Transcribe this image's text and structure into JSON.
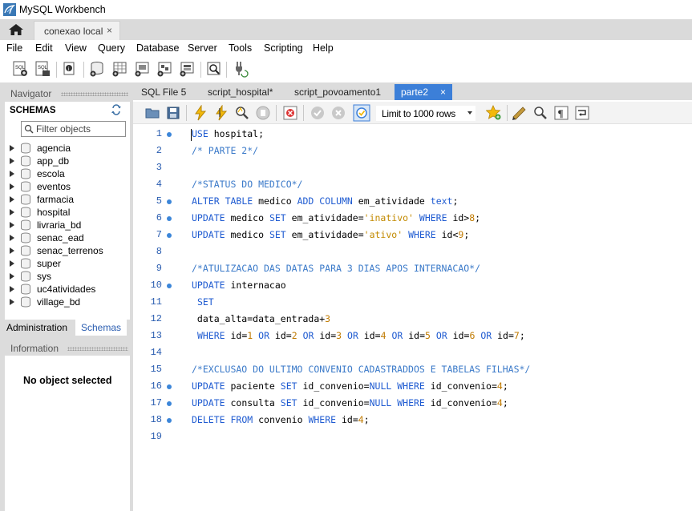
{
  "window": {
    "title": "MySQL Workbench"
  },
  "connection_tab": {
    "label": "conexao local",
    "close": "×"
  },
  "menu": [
    "File",
    "Edit",
    "View",
    "Query",
    "Database",
    "Server",
    "Tools",
    "Scripting",
    "Help"
  ],
  "main_toolbar_icons": [
    "new-sql-tab-icon",
    "open-sql-script-icon",
    "inspector-icon",
    "create-schema-icon",
    "create-table-icon",
    "create-view-icon",
    "create-procedure-icon",
    "create-function-icon",
    "search-table-data-icon",
    "reconnect-icon"
  ],
  "navigator": {
    "title": "Navigator",
    "schemas_title": "SCHEMAS",
    "filter_placeholder": "Filter objects",
    "schemas": [
      "agencia",
      "app_db",
      "escola",
      "eventos",
      "farmacia",
      "hospital",
      "livraria_bd",
      "senac_ead",
      "senac_terrenos",
      "super",
      "sys",
      "uc4atividades",
      "village_bd"
    ],
    "tabs": [
      "Administration",
      "Schemas"
    ],
    "information_title": "Information",
    "no_object": "No object selected"
  },
  "editor": {
    "tabs": [
      {
        "label": "SQL File 5",
        "active": false
      },
      {
        "label": "script_hospital*",
        "active": false
      },
      {
        "label": "script_povoamento1",
        "active": false
      },
      {
        "label": "parte2",
        "active": true,
        "close": "×"
      }
    ],
    "limit_rows": "Limit to 1000 rows",
    "toolbar_icons": [
      "open-file-icon",
      "save-icon",
      "execute-icon",
      "execute-current-icon",
      "explain-icon",
      "stop-icon",
      "toggle-error-icon",
      "commit-icon",
      "rollback-icon",
      "autocommit-icon",
      "limit-rows-select",
      "bookmark-icon",
      "beautify-icon",
      "find-icon",
      "invisible-chars-icon",
      "wrap-icon"
    ],
    "lines": [
      {
        "n": "1",
        "bullet": true,
        "code": "USE hospital;"
      },
      {
        "n": "2",
        "bullet": false,
        "code": "/* PARTE 2*/"
      },
      {
        "n": "3",
        "bullet": false,
        "code": ""
      },
      {
        "n": "4",
        "bullet": false,
        "code": "/*STATUS DO MEDICO*/"
      },
      {
        "n": "5",
        "bullet": true,
        "code": "ALTER TABLE medico ADD COLUMN em_atividade text;"
      },
      {
        "n": "6",
        "bullet": true,
        "code": "UPDATE medico SET em_atividade='inativo' WHERE id>8;"
      },
      {
        "n": "7",
        "bullet": true,
        "code": "UPDATE medico SET em_atividade='ativo' WHERE id<9;"
      },
      {
        "n": "8",
        "bullet": false,
        "code": ""
      },
      {
        "n": "9",
        "bullet": false,
        "code": "/*ATULIZACAO DAS DATAS PARA 3 DIAS APOS INTERNACAO*/"
      },
      {
        "n": "10",
        "bullet": true,
        "code": "UPDATE internacao"
      },
      {
        "n": "11",
        "bullet": false,
        "code": " SET"
      },
      {
        "n": "12",
        "bullet": false,
        "code": " data_alta=data_entrada+3"
      },
      {
        "n": "13",
        "bullet": false,
        "code": " WHERE id=1 OR id=2 OR id=3 OR id=4 OR id=5 OR id=6 OR id=7;"
      },
      {
        "n": "14",
        "bullet": false,
        "code": ""
      },
      {
        "n": "15",
        "bullet": false,
        "code": "/*EXCLUSAO DO ULTIMO CONVENIO CADASTRADDOS E TABELAS FILHAS*/"
      },
      {
        "n": "16",
        "bullet": true,
        "code": "UPDATE paciente SET id_convenio=NULL WHERE id_convenio=4;"
      },
      {
        "n": "17",
        "bullet": true,
        "code": "UPDATE consulta SET id_convenio=NULL WHERE id_convenio=4;"
      },
      {
        "n": "18",
        "bullet": true,
        "code": "DELETE FROM convenio WHERE id=4;"
      },
      {
        "n": "19",
        "bullet": false,
        "code": ""
      }
    ]
  },
  "colors": {
    "active_tab": "#3c7fd8",
    "keyword": "#1f5bd1",
    "comment": "#3b7ac9",
    "string": "#c28a00",
    "line_number": "#2a5db0",
    "panel_gray": "#dcdcdc"
  }
}
